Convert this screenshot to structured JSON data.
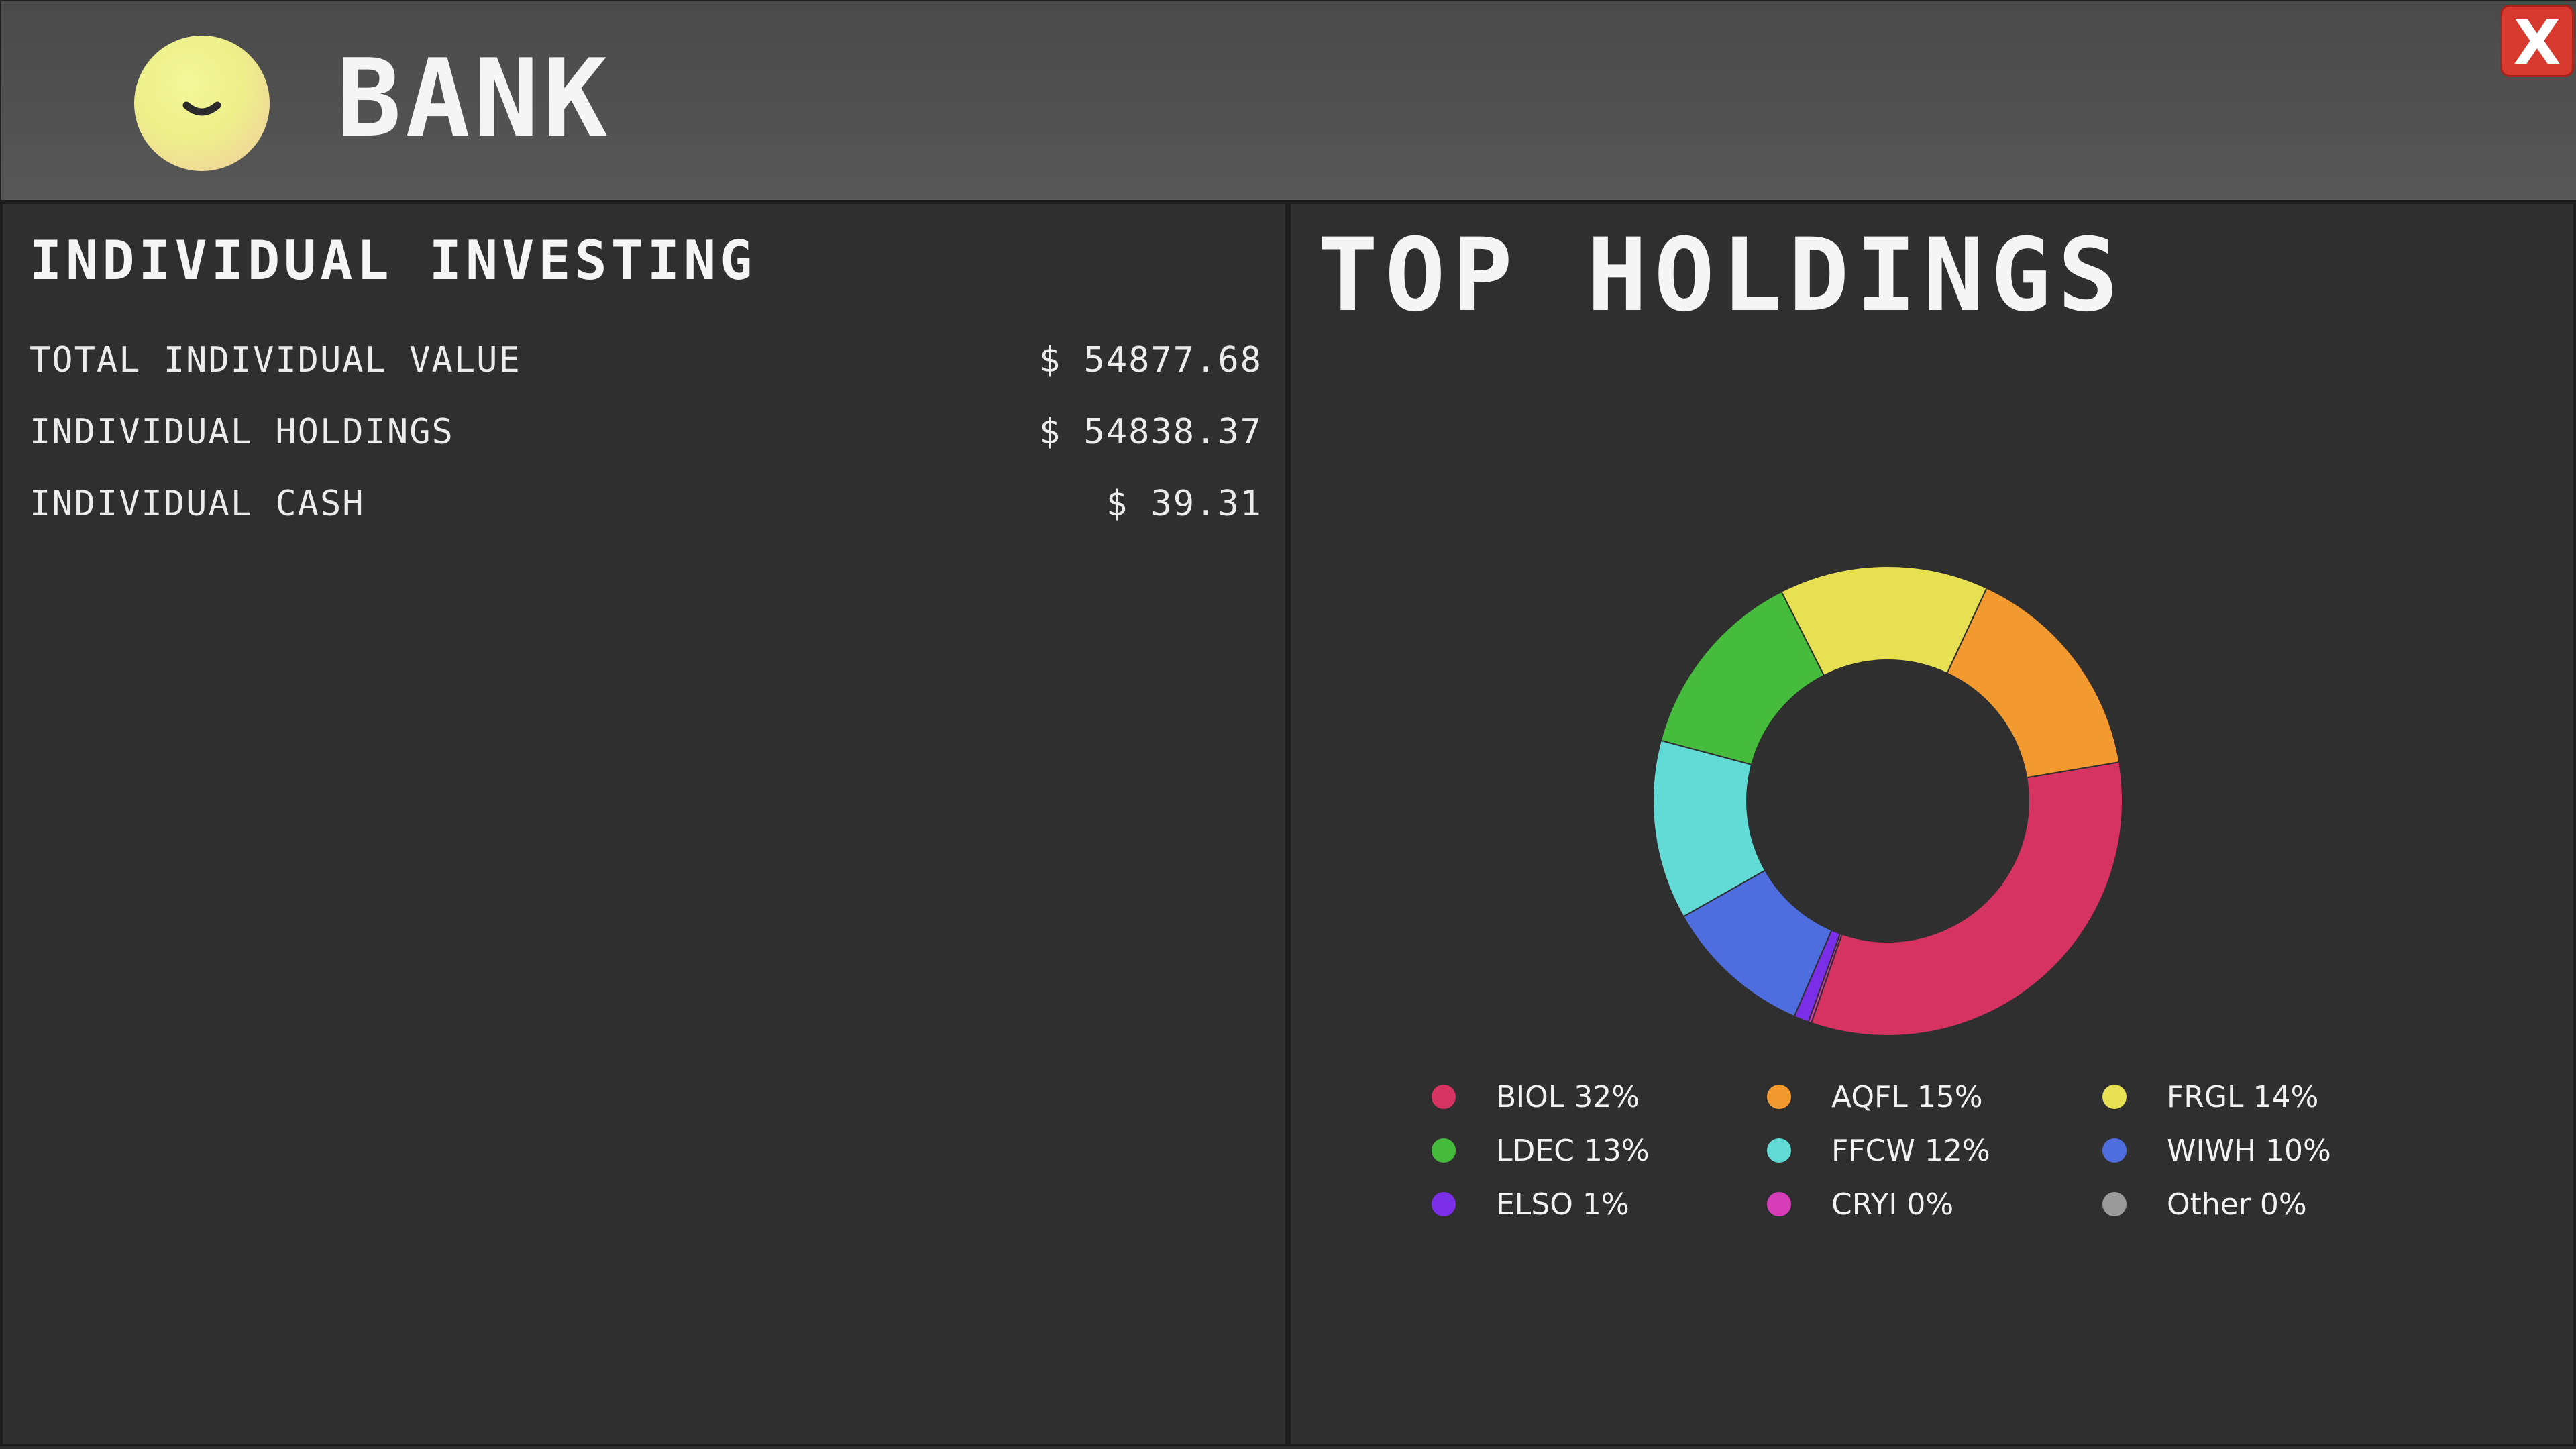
{
  "header": {
    "title": "BANK",
    "close_label": "X",
    "logo_icon": "smiley-face-icon"
  },
  "investing": {
    "title": "INDIVIDUAL INVESTING",
    "rows": [
      {
        "label": "TOTAL INDIVIDUAL VALUE",
        "value": "$ 54877.68"
      },
      {
        "label": "INDIVIDUAL HOLDINGS",
        "value": "$ 54838.37"
      },
      {
        "label": "INDIVIDUAL CASH",
        "value": "$ 39.31"
      }
    ]
  },
  "holdings": {
    "title": "TOP HOLDINGS",
    "legend": [
      {
        "label": "BIOL 32%",
        "color": "#d63262"
      },
      {
        "label": "AQFL 15%",
        "color": "#f29a30"
      },
      {
        "label": "FRGL 14%",
        "color": "#e6e052"
      },
      {
        "label": "LDEC 13%",
        "color": "#46bc3c"
      },
      {
        "label": "FFCW 12%",
        "color": "#62dad6"
      },
      {
        "label": "WIWH 10%",
        "color": "#4e6ee0"
      },
      {
        "label": "ELSO 1%",
        "color": "#7a2ee8"
      },
      {
        "label": "CRYI 0%",
        "color": "#d63cb8"
      },
      {
        "label": "Other 0%",
        "color": "#9a9a9a"
      }
    ]
  },
  "chart_data": {
    "type": "pie",
    "title": "TOP HOLDINGS",
    "categories": [
      "BIOL",
      "AQFL",
      "FRGL",
      "LDEC",
      "FFCW",
      "WIWH",
      "ELSO",
      "CRYI",
      "Other"
    ],
    "values": [
      32,
      15,
      14,
      13,
      12,
      10,
      1,
      0.2,
      0
    ],
    "colors": [
      "#d63262",
      "#f29a30",
      "#e6e052",
      "#46bc3c",
      "#62dad6",
      "#4e6ee0",
      "#7a2ee8",
      "#d63cb8",
      "#9a9a9a"
    ],
    "donut": true,
    "legend_position": "bottom"
  }
}
